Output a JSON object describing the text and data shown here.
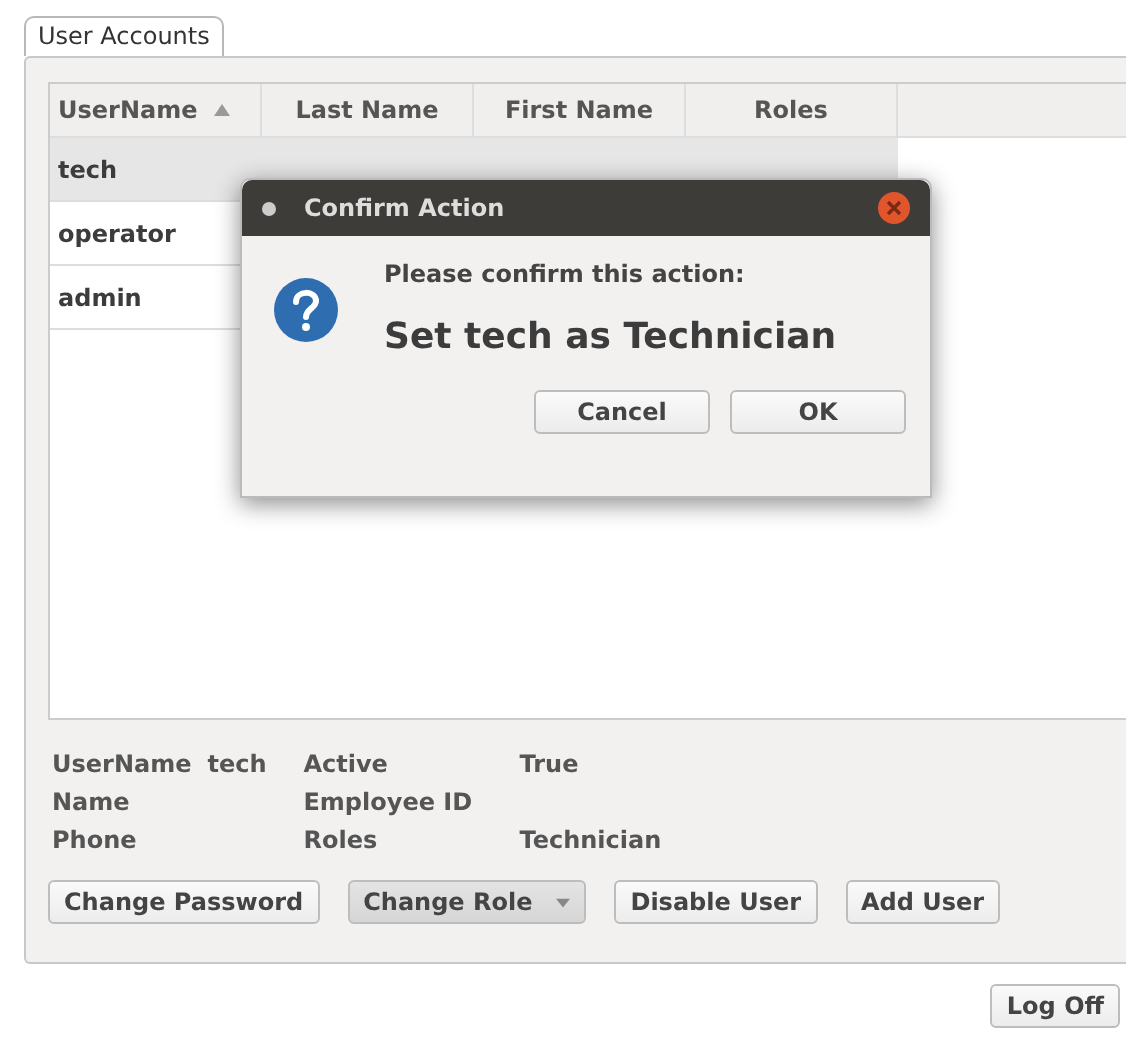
{
  "tabs": [
    {
      "label": "User Accounts",
      "selected": true
    }
  ],
  "table": {
    "columns": [
      {
        "label": "UserName",
        "sorted": true
      },
      {
        "label": "Last Name",
        "sorted": false
      },
      {
        "label": "First Name",
        "sorted": false
      },
      {
        "label": "Roles",
        "sorted": false
      }
    ],
    "rows": [
      {
        "cells": [
          "tech"
        ],
        "selected": true
      },
      {
        "cells": [
          "operator"
        ],
        "selected": false
      },
      {
        "cells": [
          "admin"
        ],
        "selected": false
      }
    ]
  },
  "details": [
    {
      "label": "UserName",
      "value": "tech",
      "label2": "Active",
      "value2": "True"
    },
    {
      "label": "Name",
      "label2": "Employee ID"
    },
    {
      "label": "Phone",
      "label2": "Roles",
      "value2": "Technician"
    }
  ],
  "buttons": [
    {
      "label": "Change Password",
      "kind": "plain"
    },
    {
      "label": "Change Role",
      "kind": "dropdown"
    },
    {
      "label": "Disable User",
      "kind": "plain"
    },
    {
      "label": "Add User",
      "kind": "plain"
    }
  ],
  "log_off": "Log Off",
  "dialog": {
    "title": "Confirm Action",
    "prompt": "Please confirm this action:",
    "message": "Set tech as Technician",
    "buttons": [
      "Cancel",
      "OK"
    ]
  }
}
